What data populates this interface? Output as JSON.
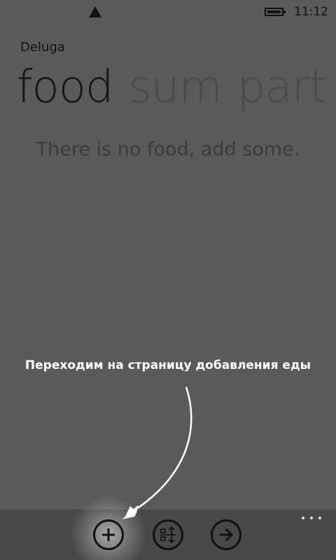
{
  "status_bar": {
    "time": "11:12",
    "icons": [
      "signal-icon",
      "battery-icon"
    ]
  },
  "app": {
    "title": "Deluga"
  },
  "pivot": {
    "items": [
      {
        "label": "food",
        "active": true
      },
      {
        "label": "sum",
        "active": false
      },
      {
        "label": "part",
        "active": false
      }
    ]
  },
  "content": {
    "empty_message": "There is no food, add some."
  },
  "annotation": {
    "text": "Переходим на страницу добавления еды"
  },
  "app_bar": {
    "buttons": [
      {
        "icon": "add-icon"
      },
      {
        "icon": "sort-icon"
      },
      {
        "icon": "arrow-right-icon"
      }
    ],
    "more": "more-icon"
  },
  "colors": {
    "background": "#5a5a5a",
    "app_bar": "#484848",
    "foreground": "#111111",
    "annotation": "#ffffff"
  }
}
